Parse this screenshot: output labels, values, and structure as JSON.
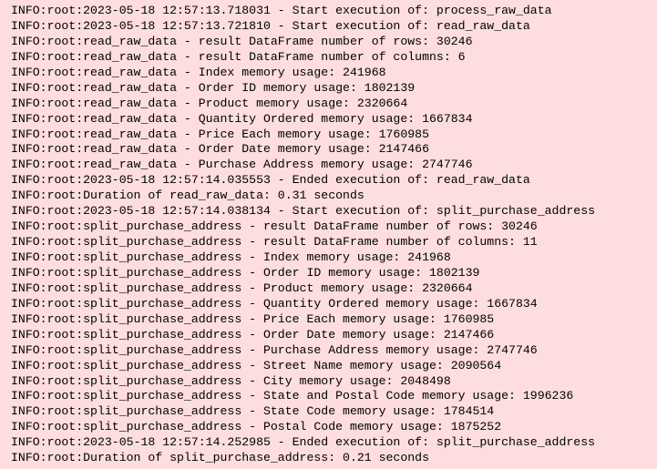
{
  "colors": {
    "background": "#fddddd",
    "text": "#000000"
  },
  "log": {
    "lines": [
      "INFO:root:2023-05-18 12:57:13.718031 - Start execution of: process_raw_data",
      "INFO:root:2023-05-18 12:57:13.721810 - Start execution of: read_raw_data",
      "INFO:root:read_raw_data - result DataFrame number of rows: 30246",
      "INFO:root:read_raw_data - result DataFrame number of columns: 6",
      "INFO:root:read_raw_data - Index memory usage: 241968",
      "INFO:root:read_raw_data - Order ID memory usage: 1802139",
      "INFO:root:read_raw_data - Product memory usage: 2320664",
      "INFO:root:read_raw_data - Quantity Ordered memory usage: 1667834",
      "INFO:root:read_raw_data - Price Each memory usage: 1760985",
      "INFO:root:read_raw_data - Order Date memory usage: 2147466",
      "INFO:root:read_raw_data - Purchase Address memory usage: 2747746",
      "INFO:root:2023-05-18 12:57:14.035553 - Ended execution of: read_raw_data",
      "INFO:root:Duration of read_raw_data: 0.31 seconds",
      "INFO:root:2023-05-18 12:57:14.038134 - Start execution of: split_purchase_address",
      "INFO:root:split_purchase_address - result DataFrame number of rows: 30246",
      "INFO:root:split_purchase_address - result DataFrame number of columns: 11",
      "INFO:root:split_purchase_address - Index memory usage: 241968",
      "INFO:root:split_purchase_address - Order ID memory usage: 1802139",
      "INFO:root:split_purchase_address - Product memory usage: 2320664",
      "INFO:root:split_purchase_address - Quantity Ordered memory usage: 1667834",
      "INFO:root:split_purchase_address - Price Each memory usage: 1760985",
      "INFO:root:split_purchase_address - Order Date memory usage: 2147466",
      "INFO:root:split_purchase_address - Purchase Address memory usage: 2747746",
      "INFO:root:split_purchase_address - Street Name memory usage: 2090564",
      "INFO:root:split_purchase_address - City memory usage: 2048498",
      "INFO:root:split_purchase_address - State and Postal Code memory usage: 1996236",
      "INFO:root:split_purchase_address - State Code memory usage: 1784514",
      "INFO:root:split_purchase_address - Postal Code memory usage: 1875252",
      "INFO:root:2023-05-18 12:57:14.252985 - Ended execution of: split_purchase_address",
      "INFO:root:Duration of split_purchase_address: 0.21 seconds"
    ]
  }
}
